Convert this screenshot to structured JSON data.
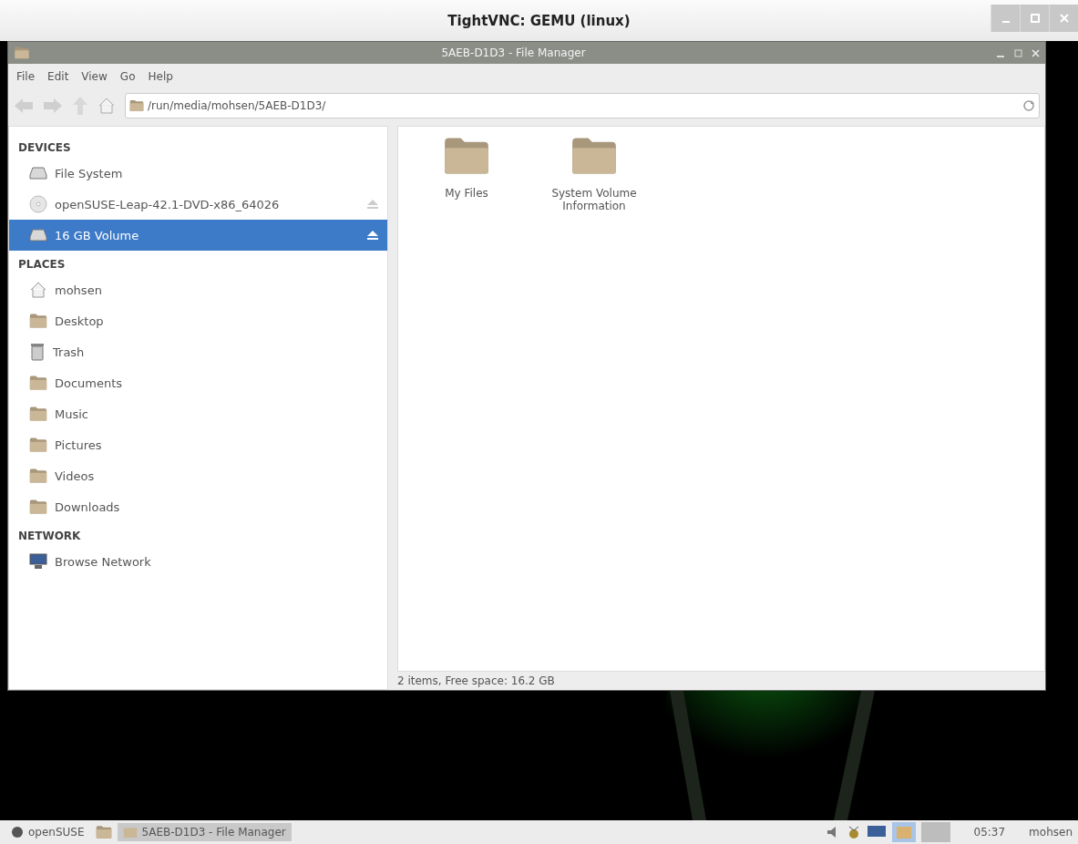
{
  "vnc_window": {
    "title": "TightVNC: GEMU (linux)"
  },
  "file_manager": {
    "title": "5AEB-D1D3 - File Manager",
    "menu": [
      "File",
      "Edit",
      "View",
      "Go",
      "Help"
    ],
    "address": "/run/media/mohsen/5AEB-D1D3/",
    "sidebar": [
      {
        "heading": "DEVICES",
        "items": [
          {
            "label": "File System",
            "kind": "drive",
            "selected": false,
            "eject": false
          },
          {
            "label": "openSUSE-Leap-42.1-DVD-x86_64026",
            "kind": "disc",
            "selected": false,
            "eject": true
          },
          {
            "label": "16 GB Volume",
            "kind": "drive",
            "selected": true,
            "eject": true
          }
        ]
      },
      {
        "heading": "PLACES",
        "items": [
          {
            "label": "mohsen",
            "kind": "home",
            "selected": false,
            "eject": false
          },
          {
            "label": "Desktop",
            "kind": "folder",
            "selected": false,
            "eject": false
          },
          {
            "label": "Trash",
            "kind": "trash",
            "selected": false,
            "eject": false
          },
          {
            "label": "Documents",
            "kind": "folder",
            "selected": false,
            "eject": false
          },
          {
            "label": "Music",
            "kind": "folder",
            "selected": false,
            "eject": false
          },
          {
            "label": "Pictures",
            "kind": "folder",
            "selected": false,
            "eject": false
          },
          {
            "label": "Videos",
            "kind": "folder",
            "selected": false,
            "eject": false
          },
          {
            "label": "Downloads",
            "kind": "folder",
            "selected": false,
            "eject": false
          }
        ]
      },
      {
        "heading": "NETWORK",
        "items": [
          {
            "label": "Browse Network",
            "kind": "network",
            "selected": false,
            "eject": false
          }
        ]
      }
    ],
    "files": [
      {
        "name": "My Files"
      },
      {
        "name": "System Volume Information"
      }
    ],
    "status": "2 items, Free space: 16.2 GB"
  },
  "taskbar": {
    "start": "openSUSE",
    "tasks": [
      {
        "label": "5AEB-D1D3 - File Manager",
        "selected": true
      }
    ],
    "clock": "05:37",
    "user": "mohsen"
  }
}
